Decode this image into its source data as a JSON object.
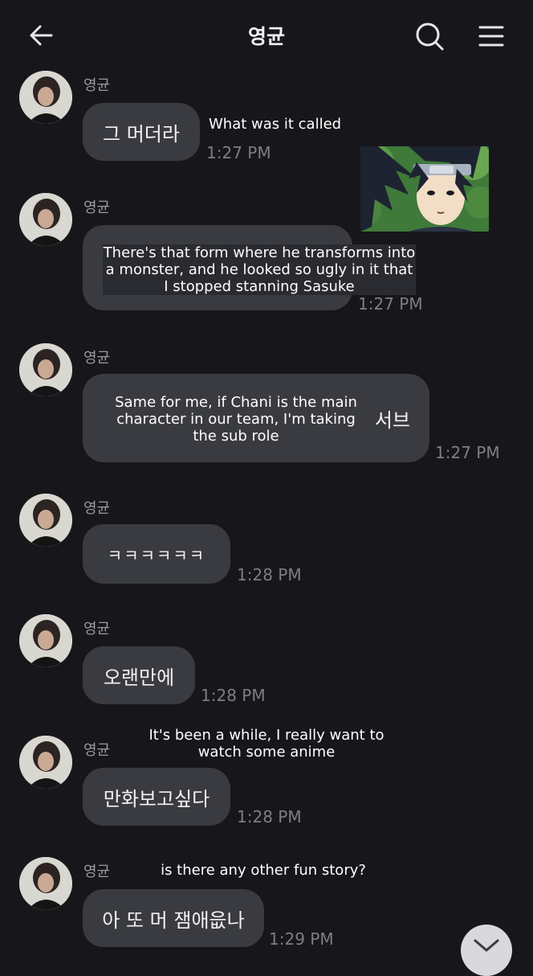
{
  "header": {
    "title": "영균",
    "back_icon": "arrow-left-icon",
    "search_icon": "search-icon",
    "menu_icon": "hamburger-menu-icon"
  },
  "messages": [
    {
      "sender": "영균",
      "text": "그 머더라",
      "time": "1:27 PM",
      "translation": "What was it called"
    },
    {
      "sender": "영균",
      "text": "",
      "time": "1:27 PM",
      "translation": "There's that form where he transforms into a monster, and he looked so ugly in it that I stopped stanning Sasuke"
    },
    {
      "sender": "영균",
      "text": "서브",
      "time": "1:27 PM",
      "translation": "Same for me, if Chani is the main character in our team, I'm taking the sub role"
    },
    {
      "sender": "영균",
      "text": "ㅋㅋㅋㅋㅋㅋ",
      "time": "1:28 PM",
      "translation": ""
    },
    {
      "sender": "영균",
      "text": "오랜만에",
      "time": "1:28 PM",
      "translation": ""
    },
    {
      "sender": "영균",
      "text": "만화보고싶다",
      "time": "1:28 PM",
      "translation": "It's been a while, I really want to watch some anime"
    },
    {
      "sender": "영균",
      "text": "아 또 머 잼애읎나",
      "time": "1:29 PM",
      "translation": "is there any other fun story?"
    }
  ],
  "scroll_button_icon": "chevron-down-icon"
}
